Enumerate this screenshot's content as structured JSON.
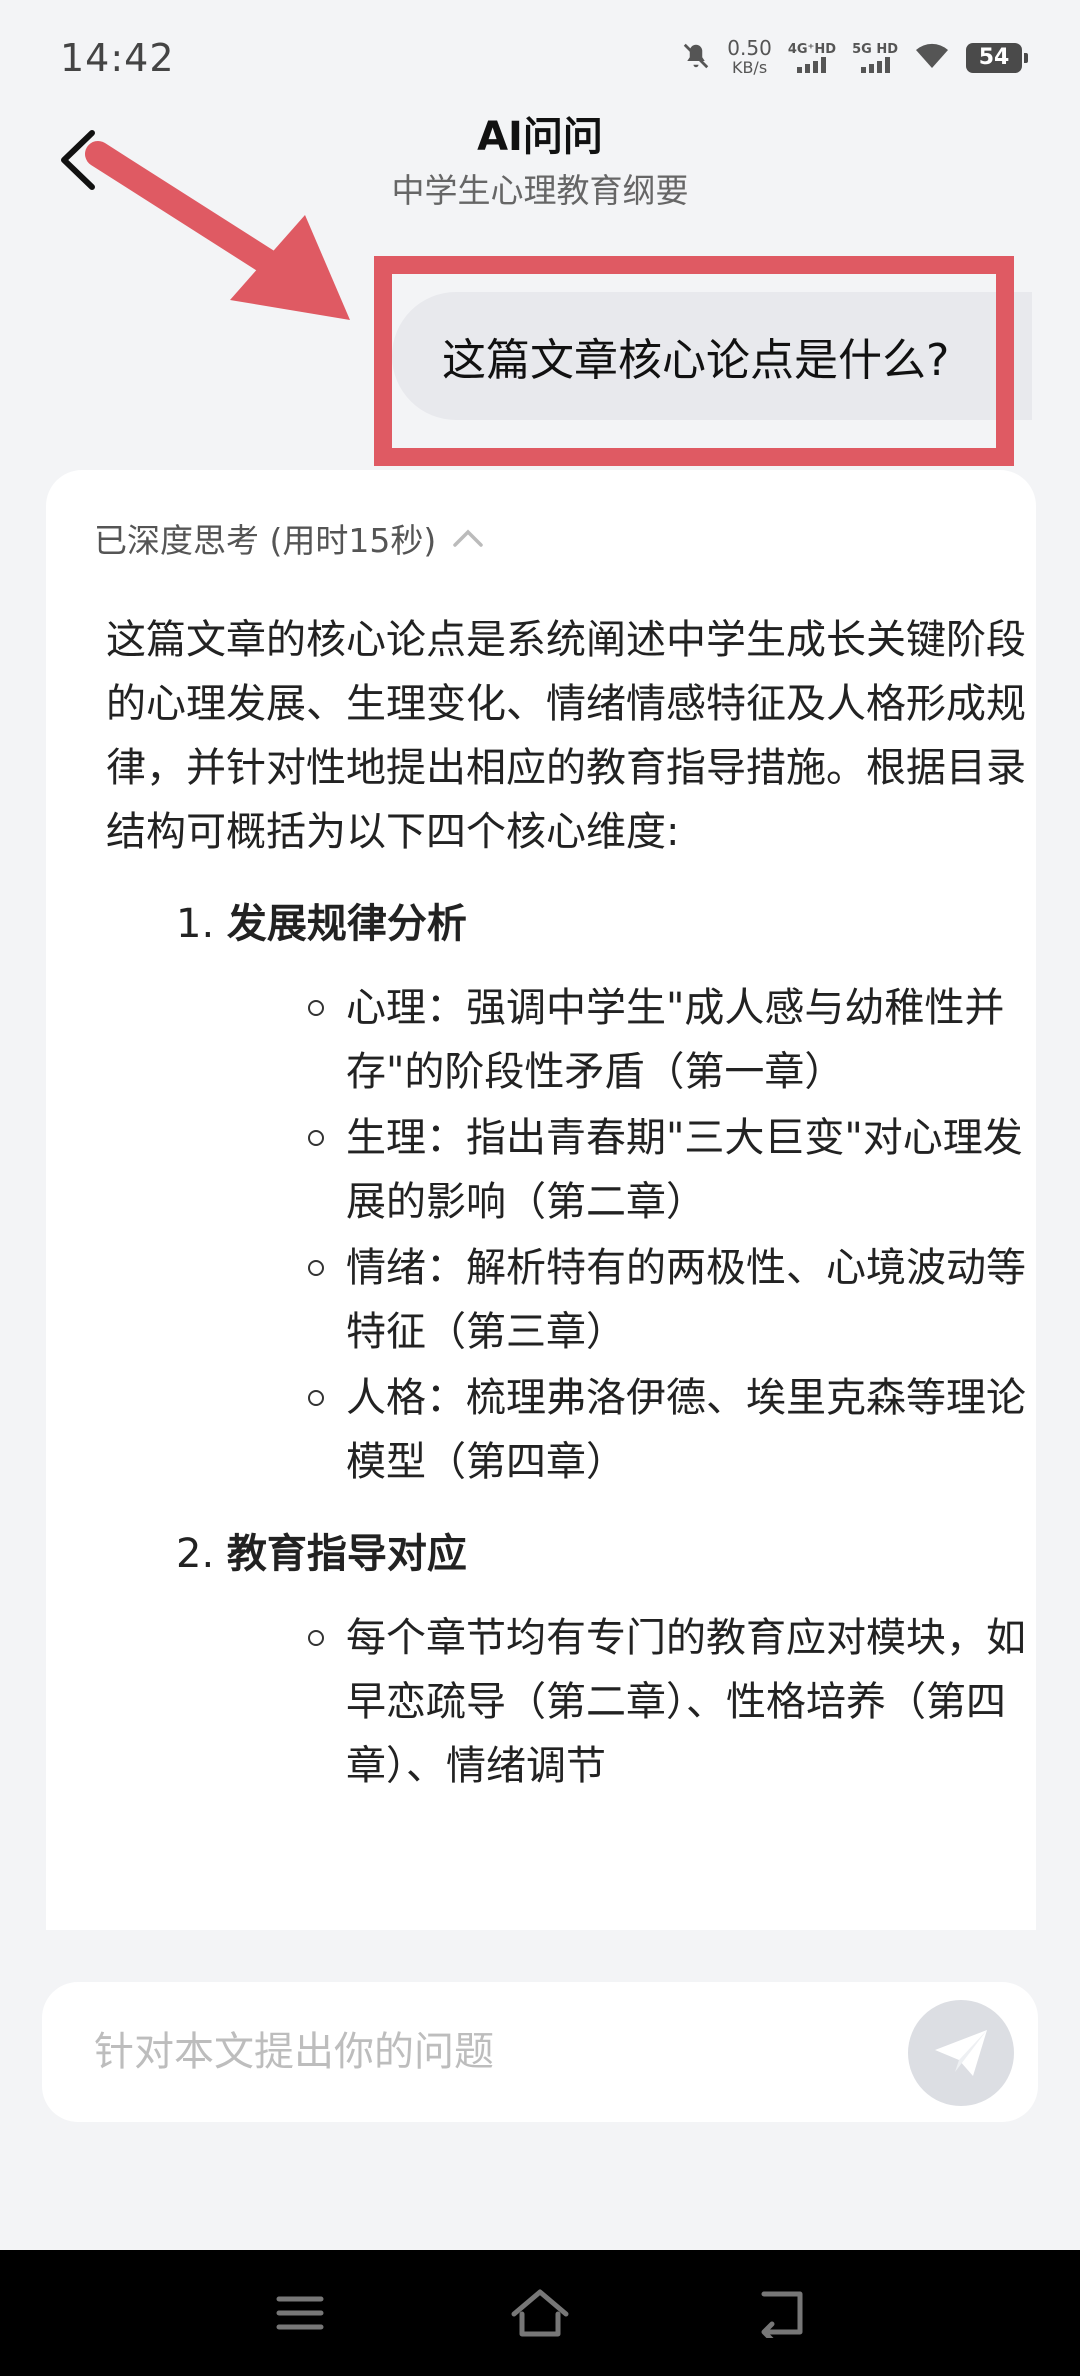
{
  "status_bar": {
    "time": "14:42",
    "net_speed_value": "0.50",
    "net_speed_unit": "KB/s",
    "sim1_label": "4G⁺HD",
    "sim2_label": "5G HD",
    "battery": "54"
  },
  "header": {
    "title": "AI问问",
    "subtitle": "中学生心理教育纲要"
  },
  "chat": {
    "user_message": "这篇文章核心论点是什么?",
    "thinking_label": "已深度思考 (用时15秒)",
    "answer_intro": "这篇文章的核心论点是系统阐述中学生成长关键阶段的心理发展、生理变化、情绪情感特征及人格形成规律，并针对性地提出相应的教育指导措施。根据目录结构可概括为以下四个核心维度:",
    "sections": [
      {
        "number": "1.",
        "title": "发展规律分析",
        "items": [
          "心理：强调中学生\"成人感与幼稚性并存\"的阶段性矛盾（第一章）",
          "生理：指出青春期\"三大巨变\"对心理发展的影响（第二章）",
          "情绪：解析特有的两极性、心境波动等特征（第三章）",
          "人格：梳理弗洛伊德、埃里克森等理论模型（第四章）"
        ]
      },
      {
        "number": "2.",
        "title": "教育指导对应",
        "items": [
          "每个章节均有专门的教育应对模块，如早恋疏导（第二章）、性格培养（第四章）、情绪调节"
        ]
      }
    ]
  },
  "input": {
    "placeholder": "针对本文提出你的问题"
  },
  "colors": {
    "annotation_red": "#df5a63",
    "background": "#f3f4f6",
    "user_bubble": "#e8e9ed"
  }
}
